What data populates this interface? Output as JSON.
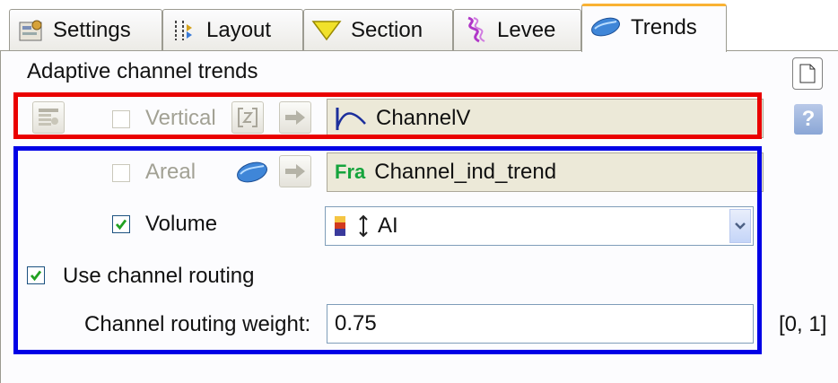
{
  "tabs": [
    {
      "label": "Settings",
      "icon": "settings-icon"
    },
    {
      "label": "Layout",
      "icon": "layout-icon"
    },
    {
      "label": "Section",
      "icon": "section-icon"
    },
    {
      "label": "Levee",
      "icon": "levee-icon"
    },
    {
      "label": "Trends",
      "icon": "trends-icon",
      "active": true
    }
  ],
  "panel": {
    "title": "Adaptive channel trends",
    "vertical": {
      "label": "Vertical",
      "checked": false,
      "enabled": false,
      "value": "ChannelV"
    },
    "areal": {
      "label": "Areal",
      "checked": false,
      "enabled": false,
      "value": "Channel_ind_trend",
      "value_icon_text": "Fra"
    },
    "volume": {
      "label": "Volume",
      "checked": true,
      "value": "AI"
    },
    "routing": {
      "label": "Use channel routing",
      "checked": true
    },
    "weight": {
      "label": "Channel routing weight:",
      "value": "0.75",
      "range": "[0, 1]"
    }
  },
  "sidebar": {
    "new_icon": "new-document-icon",
    "help_label": "?"
  },
  "colors": {
    "highlight_red": "#ea0000",
    "highlight_blue": "#0000e6",
    "active_tab_accent": "#f9b233"
  }
}
